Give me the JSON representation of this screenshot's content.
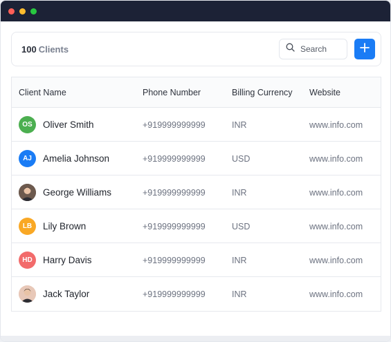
{
  "window": {
    "dots": [
      "#ff5f57",
      "#febc2e",
      "#28c840"
    ]
  },
  "toolbar": {
    "count": "100",
    "count_label": "Clients",
    "search_placeholder": "Search",
    "add_icon": "plus-icon"
  },
  "table": {
    "headers": [
      "Client Name",
      "Phone Number",
      "Billing Currency",
      "Website"
    ],
    "rows": [
      {
        "initials": "OS",
        "avatar_color": "#4caf50",
        "photo": false,
        "name": "Oliver Smith",
        "phone": "+919999999999",
        "currency": "INR",
        "website": "www.info.com"
      },
      {
        "initials": "AJ",
        "avatar_color": "#1a7cf5",
        "photo": false,
        "name": "Amelia Johnson",
        "phone": "+919999999999",
        "currency": "USD",
        "website": "www.info.com"
      },
      {
        "initials": "",
        "avatar_color": "#6d5a4e",
        "photo": true,
        "name": "George Williams",
        "phone": "+919999999999",
        "currency": "INR",
        "website": "www.info.com"
      },
      {
        "initials": "LB",
        "avatar_color": "#f9a825",
        "photo": false,
        "name": "Lily Brown",
        "phone": "+919999999999",
        "currency": "USD",
        "website": "www.info.com"
      },
      {
        "initials": "HD",
        "avatar_color": "#f26b6b",
        "photo": false,
        "name": "Harry Davis",
        "phone": "+919999999999",
        "currency": "INR",
        "website": "www.info.com"
      },
      {
        "initials": "",
        "avatar_color": "#e8c8b8",
        "photo": true,
        "name": "Jack Taylor",
        "phone": "+919999999999",
        "currency": "INR",
        "website": "www.info.com"
      }
    ]
  }
}
